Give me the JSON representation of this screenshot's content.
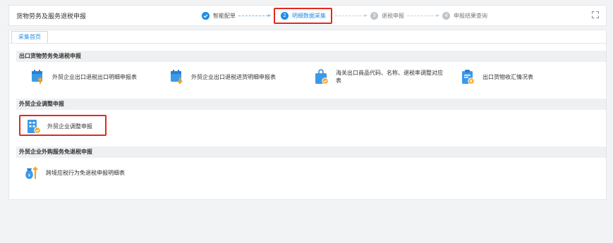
{
  "header": {
    "title": "货物劳务及服务退税申报",
    "steps": [
      {
        "number": "",
        "label": "智能配单",
        "state": "done"
      },
      {
        "number": "2",
        "label": "明细数据采集",
        "state": "active"
      },
      {
        "number": "3",
        "label": "退税申报",
        "state": "todo"
      },
      {
        "number": "4",
        "label": "申报结果查询",
        "state": "todo"
      }
    ],
    "expand_icon": "expand-icon"
  },
  "tab": {
    "label": "采集首页"
  },
  "sections": [
    {
      "title": "出口货物劳务免退税申报",
      "items": [
        {
          "label": "外贸企业出口退税出口明细申报表",
          "icon": "document-upload-icon"
        },
        {
          "label": "外贸企业出口退税进货明细申报表",
          "icon": "document-download-icon"
        },
        {
          "label": "海关出口商品代码、名称、退税率调整对应表",
          "icon": "shopping-bag-check-icon"
        },
        {
          "label": "出口货物收汇情况表",
          "icon": "clipboard-yen-icon"
        }
      ]
    },
    {
      "title": "外贸企业调整申报",
      "items": [
        {
          "label": "外贸企业调整申报",
          "icon": "building-check-icon"
        }
      ]
    },
    {
      "title": "外贸企业外购服务免退税申报",
      "items": [
        {
          "label": "跨境应税行为免退税申报明细表",
          "icon": "money-bag-arrow-icon"
        }
      ]
    }
  ],
  "colors": {
    "accent": "#1e8ee8",
    "highlight": "#e3291e",
    "icon_blue": "#3b9ae8",
    "icon_orange": "#f5a623"
  }
}
